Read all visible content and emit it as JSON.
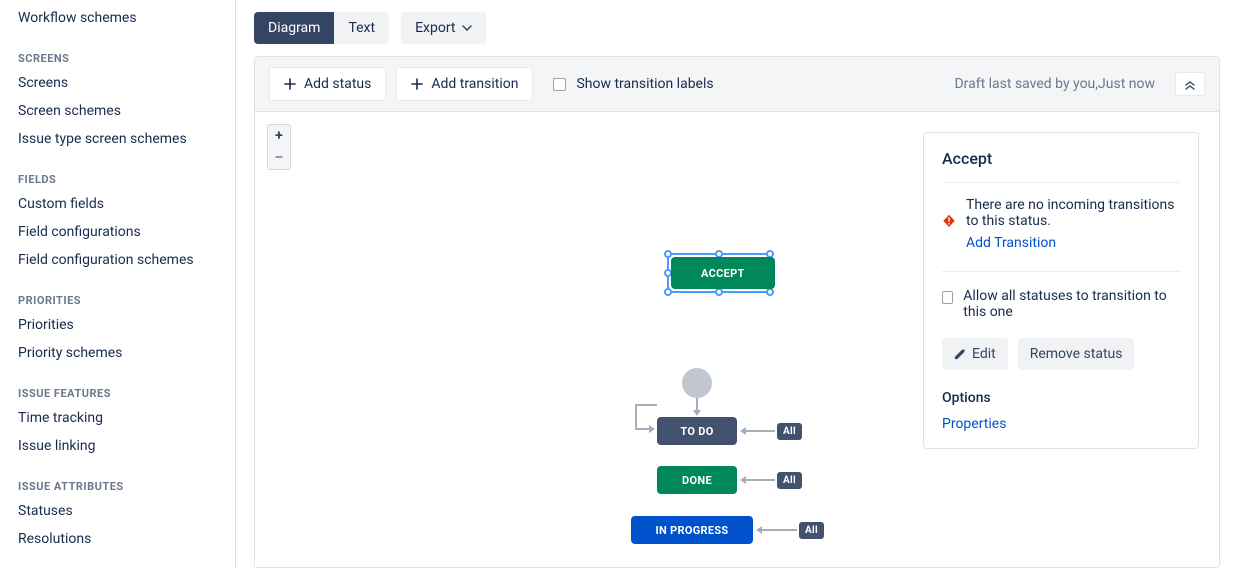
{
  "sidebar": {
    "items": [
      {
        "type": "item",
        "label": "Workflow schemes"
      },
      {
        "type": "header",
        "label": "SCREENS"
      },
      {
        "type": "item",
        "label": "Screens"
      },
      {
        "type": "item",
        "label": "Screen schemes"
      },
      {
        "type": "item",
        "label": "Issue type screen schemes"
      },
      {
        "type": "header",
        "label": "FIELDS"
      },
      {
        "type": "item",
        "label": "Custom fields"
      },
      {
        "type": "item",
        "label": "Field configurations"
      },
      {
        "type": "item",
        "label": "Field configuration schemes"
      },
      {
        "type": "header",
        "label": "PRIORITIES"
      },
      {
        "type": "item",
        "label": "Priorities"
      },
      {
        "type": "item",
        "label": "Priority schemes"
      },
      {
        "type": "header",
        "label": "ISSUE FEATURES"
      },
      {
        "type": "item",
        "label": "Time tracking"
      },
      {
        "type": "item",
        "label": "Issue linking"
      },
      {
        "type": "header",
        "label": "ISSUE ATTRIBUTES"
      },
      {
        "type": "item",
        "label": "Statuses"
      },
      {
        "type": "item",
        "label": "Resolutions"
      }
    ]
  },
  "tabs": {
    "diagram": "Diagram",
    "text": "Text",
    "active": "diagram",
    "export": "Export"
  },
  "toolbar": {
    "add_status": "Add status",
    "add_transition": "Add transition",
    "show_transition_labels": "Show transition labels",
    "show_transition_labels_checked": false,
    "draft_message": "Draft last saved by you,Just now"
  },
  "workflow": {
    "statuses": {
      "accept": {
        "label": "ACCEPT",
        "category": "done",
        "selected": true
      },
      "todo": {
        "label": "TO DO",
        "category": "todo",
        "selected": false
      },
      "done": {
        "label": "DONE",
        "category": "done",
        "selected": false
      },
      "inprogress": {
        "label": "IN PROGRESS",
        "category": "inprogress",
        "selected": false
      }
    },
    "badges": {
      "all": "All"
    }
  },
  "panel": {
    "title": "Accept",
    "warning_text": "There are no incoming transitions to this status.",
    "add_transition": "Add Transition",
    "allow_all": "Allow all statuses to transition to this one",
    "allow_all_checked": false,
    "edit": "Edit",
    "remove_status": "Remove status",
    "options_header": "Options",
    "properties": "Properties"
  }
}
